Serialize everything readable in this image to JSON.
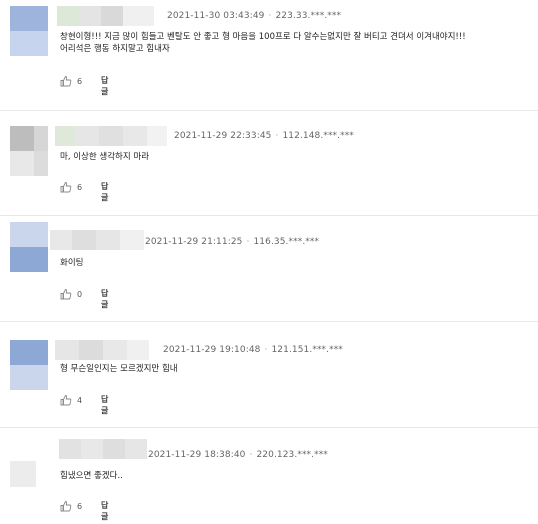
{
  "comments": [
    {
      "timestamp": "2021-11-30 03:43:49",
      "ip": "223.33.***.***",
      "lines": [
        "창현이형!!! 지금 많이 힘들고 벤탈도 안 좋고 형 마음을 100프로 다 알수는없지만 잘 버티고 견뎌서 이겨내야지!!!",
        "어리석은 행동 하지말고 힘내자"
      ],
      "likes": "6",
      "reply_label": "답글"
    },
    {
      "timestamp": "2021-11-29 22:33:45",
      "ip": "112.148.***.***",
      "lines": [
        "마, 이상한 생각하지 마라"
      ],
      "likes": "6",
      "reply_label": "답글"
    },
    {
      "timestamp": "2021-11-29 21:11:25",
      "ip": "116.35.***.***",
      "lines": [
        "화이팅"
      ],
      "likes": "0",
      "reply_label": "답글"
    },
    {
      "timestamp": "2021-11-29 19:10:48",
      "ip": "121.151.***.***",
      "lines": [
        "형 무슨일인지는 모르겠지만 힘내"
      ],
      "likes": "4",
      "reply_label": "답글"
    },
    {
      "timestamp": "2021-11-29 18:38:40",
      "ip": "220.123.***.***",
      "lines": [
        "힘냈으면 좋겠다.."
      ],
      "likes": "6",
      "reply_label": "답글"
    }
  ],
  "separator": "·",
  "icon": "thumbs-up-icon"
}
